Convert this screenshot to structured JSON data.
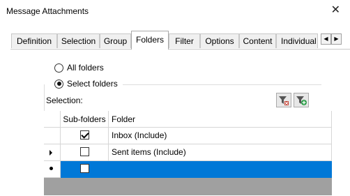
{
  "window": {
    "title": "Message Attachments",
    "close_glyph": "✕"
  },
  "tabs": [
    {
      "label": "Definition",
      "active": false
    },
    {
      "label": "Selection",
      "active": false
    },
    {
      "label": "Group",
      "active": false
    },
    {
      "label": "Folders",
      "active": true
    },
    {
      "label": "Filter",
      "active": false
    },
    {
      "label": "Options",
      "active": false
    },
    {
      "label": "Content",
      "active": false
    },
    {
      "label": "Individual",
      "active": false
    }
  ],
  "tab_scroll": {
    "left_glyph": "◀",
    "right_glyph": "▶"
  },
  "folders": {
    "radio_all": {
      "label": "All folders",
      "checked": false
    },
    "radio_select": {
      "label": "Select folders",
      "checked": true
    },
    "selection_label": "Selection:",
    "toolbar_icons": [
      "filter-delete-icon",
      "filter-add-icon"
    ],
    "grid": {
      "columns": [
        "Sub-folders",
        "Folder"
      ],
      "rows": [
        {
          "indicator": "",
          "subfolders": true,
          "folder": "Inbox (Include)"
        },
        {
          "indicator": "current-row-arrow",
          "subfolders": false,
          "folder": "Sent items (Include)"
        },
        {
          "indicator": "new-row-star",
          "subfolders": false,
          "folder": "",
          "selected": true
        }
      ]
    }
  },
  "colors": {
    "selection": "#0078d7",
    "grid_empty": "#a0a0a0"
  }
}
